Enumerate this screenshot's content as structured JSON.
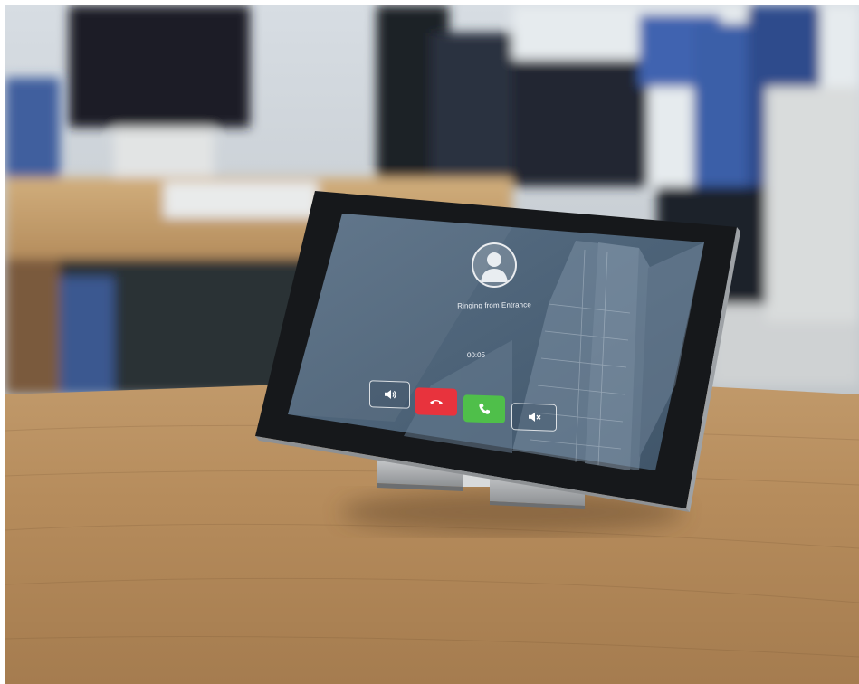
{
  "scene": {
    "description_free": true
  },
  "tablet_screen": {
    "caller_label": "Ringing from Entrance",
    "call_timer": "00:05",
    "buttons": {
      "speaker": {
        "icon": "speaker-icon"
      },
      "hangup": {
        "icon": "phone-hangup-icon",
        "color": "#e8333d"
      },
      "answer": {
        "icon": "phone-answer-icon",
        "color": "#4fbf4a"
      },
      "mute": {
        "icon": "speaker-mute-icon"
      }
    },
    "colors": {
      "screen_bg": "#4c6378",
      "bezel": "#15171a"
    }
  }
}
